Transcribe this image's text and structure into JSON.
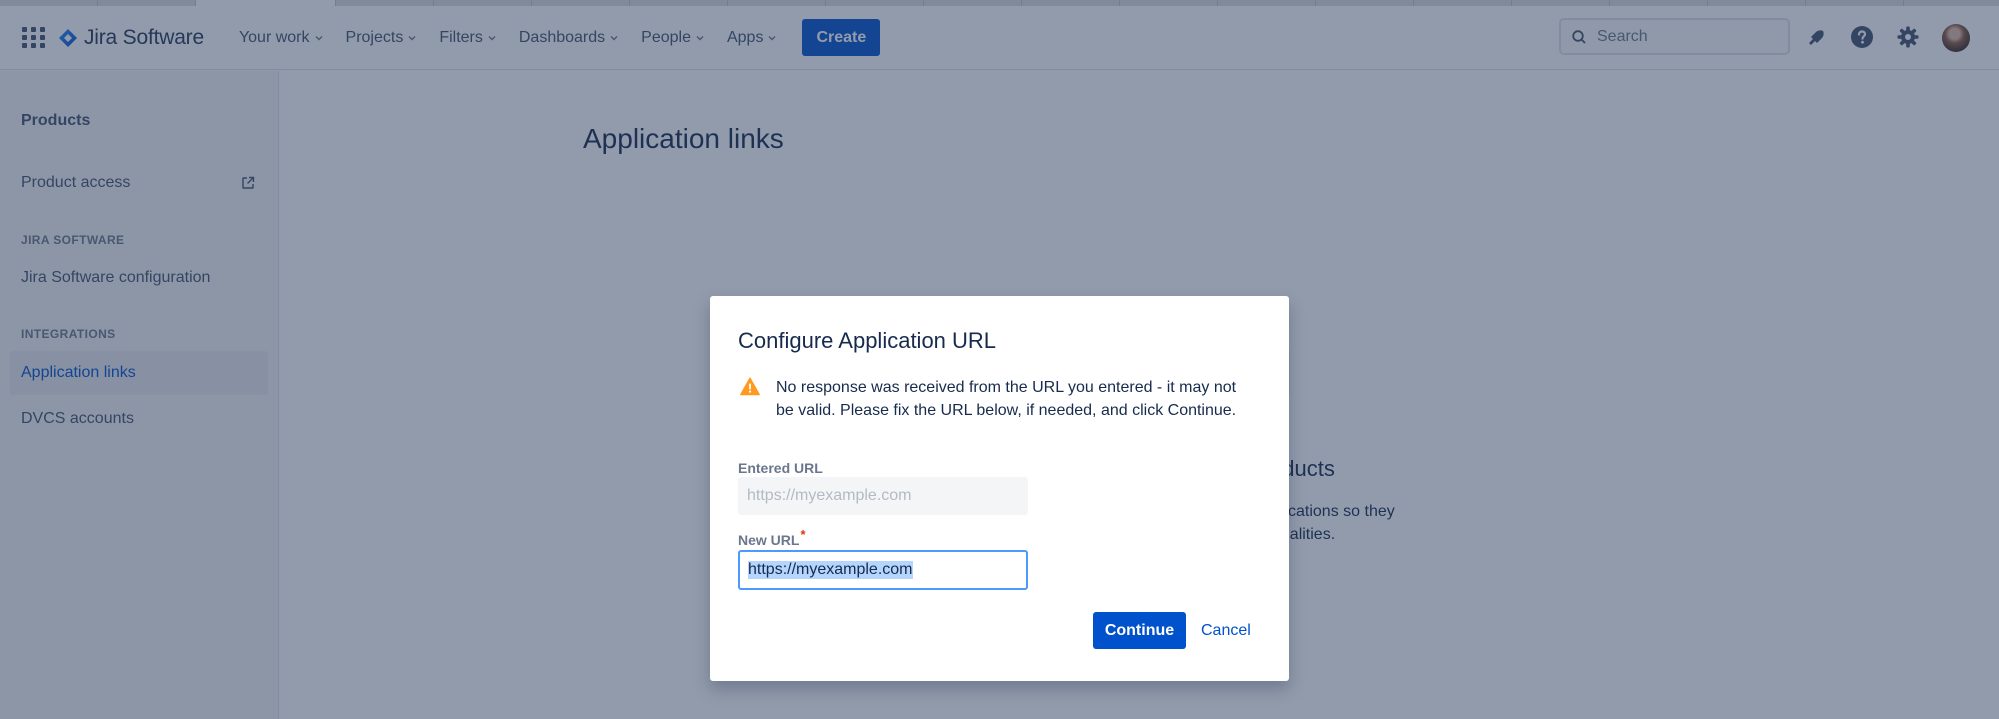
{
  "topnav": {
    "product_name": "Jira Software",
    "items": [
      {
        "label": "Your work"
      },
      {
        "label": "Projects"
      },
      {
        "label": "Filters"
      },
      {
        "label": "Dashboards"
      },
      {
        "label": "People"
      },
      {
        "label": "Apps"
      }
    ],
    "create_label": "Create",
    "search_placeholder": "Search",
    "icons": [
      "app-switcher-icon",
      "notifications-icon",
      "help-icon",
      "settings-icon"
    ]
  },
  "sidebar": {
    "title": "Products",
    "product_access": "Product access",
    "section_jira": "JIRA SOFTWARE",
    "jira_config": "Jira Software configuration",
    "section_integrations": "INTEGRATIONS",
    "app_links": "Application links",
    "dvcs": "DVCS accounts"
  },
  "main": {
    "title": "Application links",
    "bg_heading": "oducts",
    "bg_text_line1": "plications so they",
    "bg_text_line2": "onalities."
  },
  "modal": {
    "title": "Configure Application URL",
    "warning_line1": "No response was received from the URL you entered - it may not",
    "warning_line2": "be valid. Please fix the URL below, if needed, and click Continue.",
    "entered_url_label": "Entered URL",
    "entered_url_value": "https://myexample.com",
    "new_url_label": "New URL",
    "required_mark": "*",
    "new_url_value": "https://myexample.com",
    "continue_label": "Continue",
    "cancel_label": "Cancel"
  },
  "colors": {
    "brand": "#0052cc",
    "warning": "#ff991f",
    "blanket": "#253858"
  }
}
